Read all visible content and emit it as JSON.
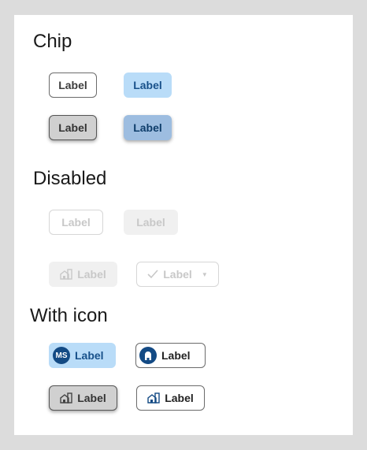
{
  "sections": {
    "chip": "Chip",
    "disabled": "Disabled",
    "with_icon": "With icon"
  },
  "chips": {
    "outline": "Label",
    "filled": "Label",
    "pressed_outline": "Label",
    "pressed_filled": "Label",
    "disabled_outline": "Label",
    "disabled_filled": "Label",
    "disabled_building": "Label",
    "disabled_dropdown": "Label",
    "avatar_chip": "Label",
    "avatar_initials": "MS",
    "account_chip": "Label",
    "pressed_building": "Label",
    "building_outline": "Label"
  },
  "icons": {
    "building": "building-icon",
    "check": "check-icon",
    "caret": "caret-down-icon",
    "account": "account-icon"
  },
  "colors": {
    "accent": "#134a84",
    "filled_bg": "#b9dcf8",
    "pressed_bg": "#9dbde0",
    "disabled_text": "#c8c8c8"
  }
}
